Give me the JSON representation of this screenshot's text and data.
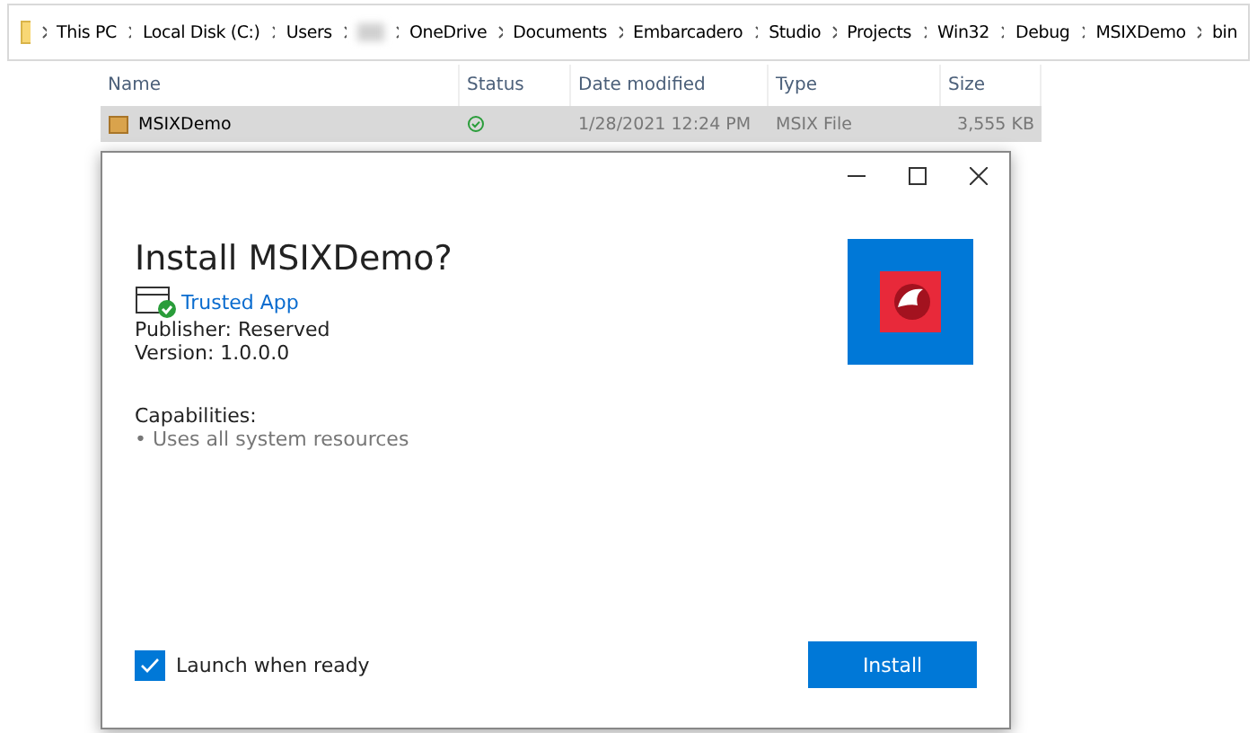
{
  "breadcrumb": [
    {
      "kind": "text",
      "label": "This PC"
    },
    {
      "kind": "text",
      "label": "Local Disk (C:)"
    },
    {
      "kind": "text",
      "label": "Users"
    },
    {
      "kind": "redacted"
    },
    {
      "kind": "text",
      "label": "OneDrive"
    },
    {
      "kind": "text",
      "label": "Documents"
    },
    {
      "kind": "text",
      "label": "Embarcadero"
    },
    {
      "kind": "text",
      "label": "Studio"
    },
    {
      "kind": "text",
      "label": "Projects"
    },
    {
      "kind": "text",
      "label": "Win32"
    },
    {
      "kind": "text",
      "label": "Debug"
    },
    {
      "kind": "text",
      "label": "MSIXDemo"
    },
    {
      "kind": "text",
      "label": "bin"
    }
  ],
  "file_list": {
    "columns": [
      "Name",
      "Status",
      "Date modified",
      "Type",
      "Size"
    ],
    "rows": [
      {
        "selected": true,
        "cells": [
          "MSIXDemo",
          "",
          "1/28/2021 12:24 PM",
          "MSIX File",
          "3,555 KB"
        ]
      }
    ]
  },
  "dialog": {
    "title": "Install MSIXDemo?",
    "trust": "Trusted App",
    "publisher": "Publisher: Reserved",
    "version": "Version: 1.0.0.0",
    "capabilities_heading": "Capabilities:",
    "capabilities": [
      "• Uses all system resources"
    ],
    "launch": {
      "label": "Launch when ready",
      "checked": true
    },
    "install_button": "Install"
  }
}
